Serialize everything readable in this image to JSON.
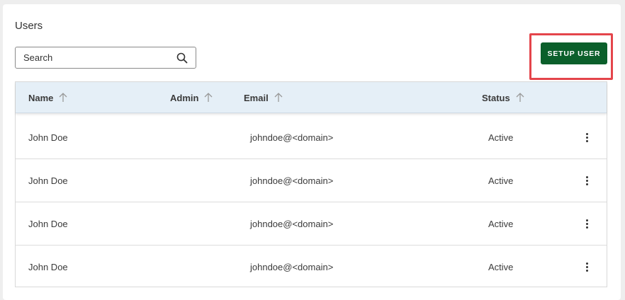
{
  "page": {
    "title": "Users"
  },
  "search": {
    "label": "Search",
    "icon": "search-icon"
  },
  "toolbar": {
    "setup_user_label": "SETUP USER",
    "setup_user_color": "#0b5f2b",
    "highlight_color": "#e4454b"
  },
  "table": {
    "columns": [
      {
        "label": "Name",
        "sort_icon": "arrow-up-icon"
      },
      {
        "label": "Admin",
        "sort_icon": "arrow-up-icon"
      },
      {
        "label": "Email",
        "sort_icon": "arrow-up-icon"
      },
      {
        "label": "Status",
        "sort_icon": "arrow-up-icon"
      }
    ],
    "header_color": "#e5eff7",
    "rows": [
      {
        "name": "John Doe",
        "admin": "",
        "email": "johndoe@<domain>",
        "status": "Active",
        "menu_icon": "more-vertical-icon"
      },
      {
        "name": "John Doe",
        "admin": "",
        "email": "johndoe@<domain>",
        "status": "Active",
        "menu_icon": "more-vertical-icon"
      },
      {
        "name": "John Doe",
        "admin": "",
        "email": "johndoe@<domain>",
        "status": "Active",
        "menu_icon": "more-vertical-icon"
      },
      {
        "name": "John Doe",
        "admin": "",
        "email": "johndoe@<domain>",
        "status": "Active",
        "menu_icon": "more-vertical-icon"
      }
    ]
  }
}
